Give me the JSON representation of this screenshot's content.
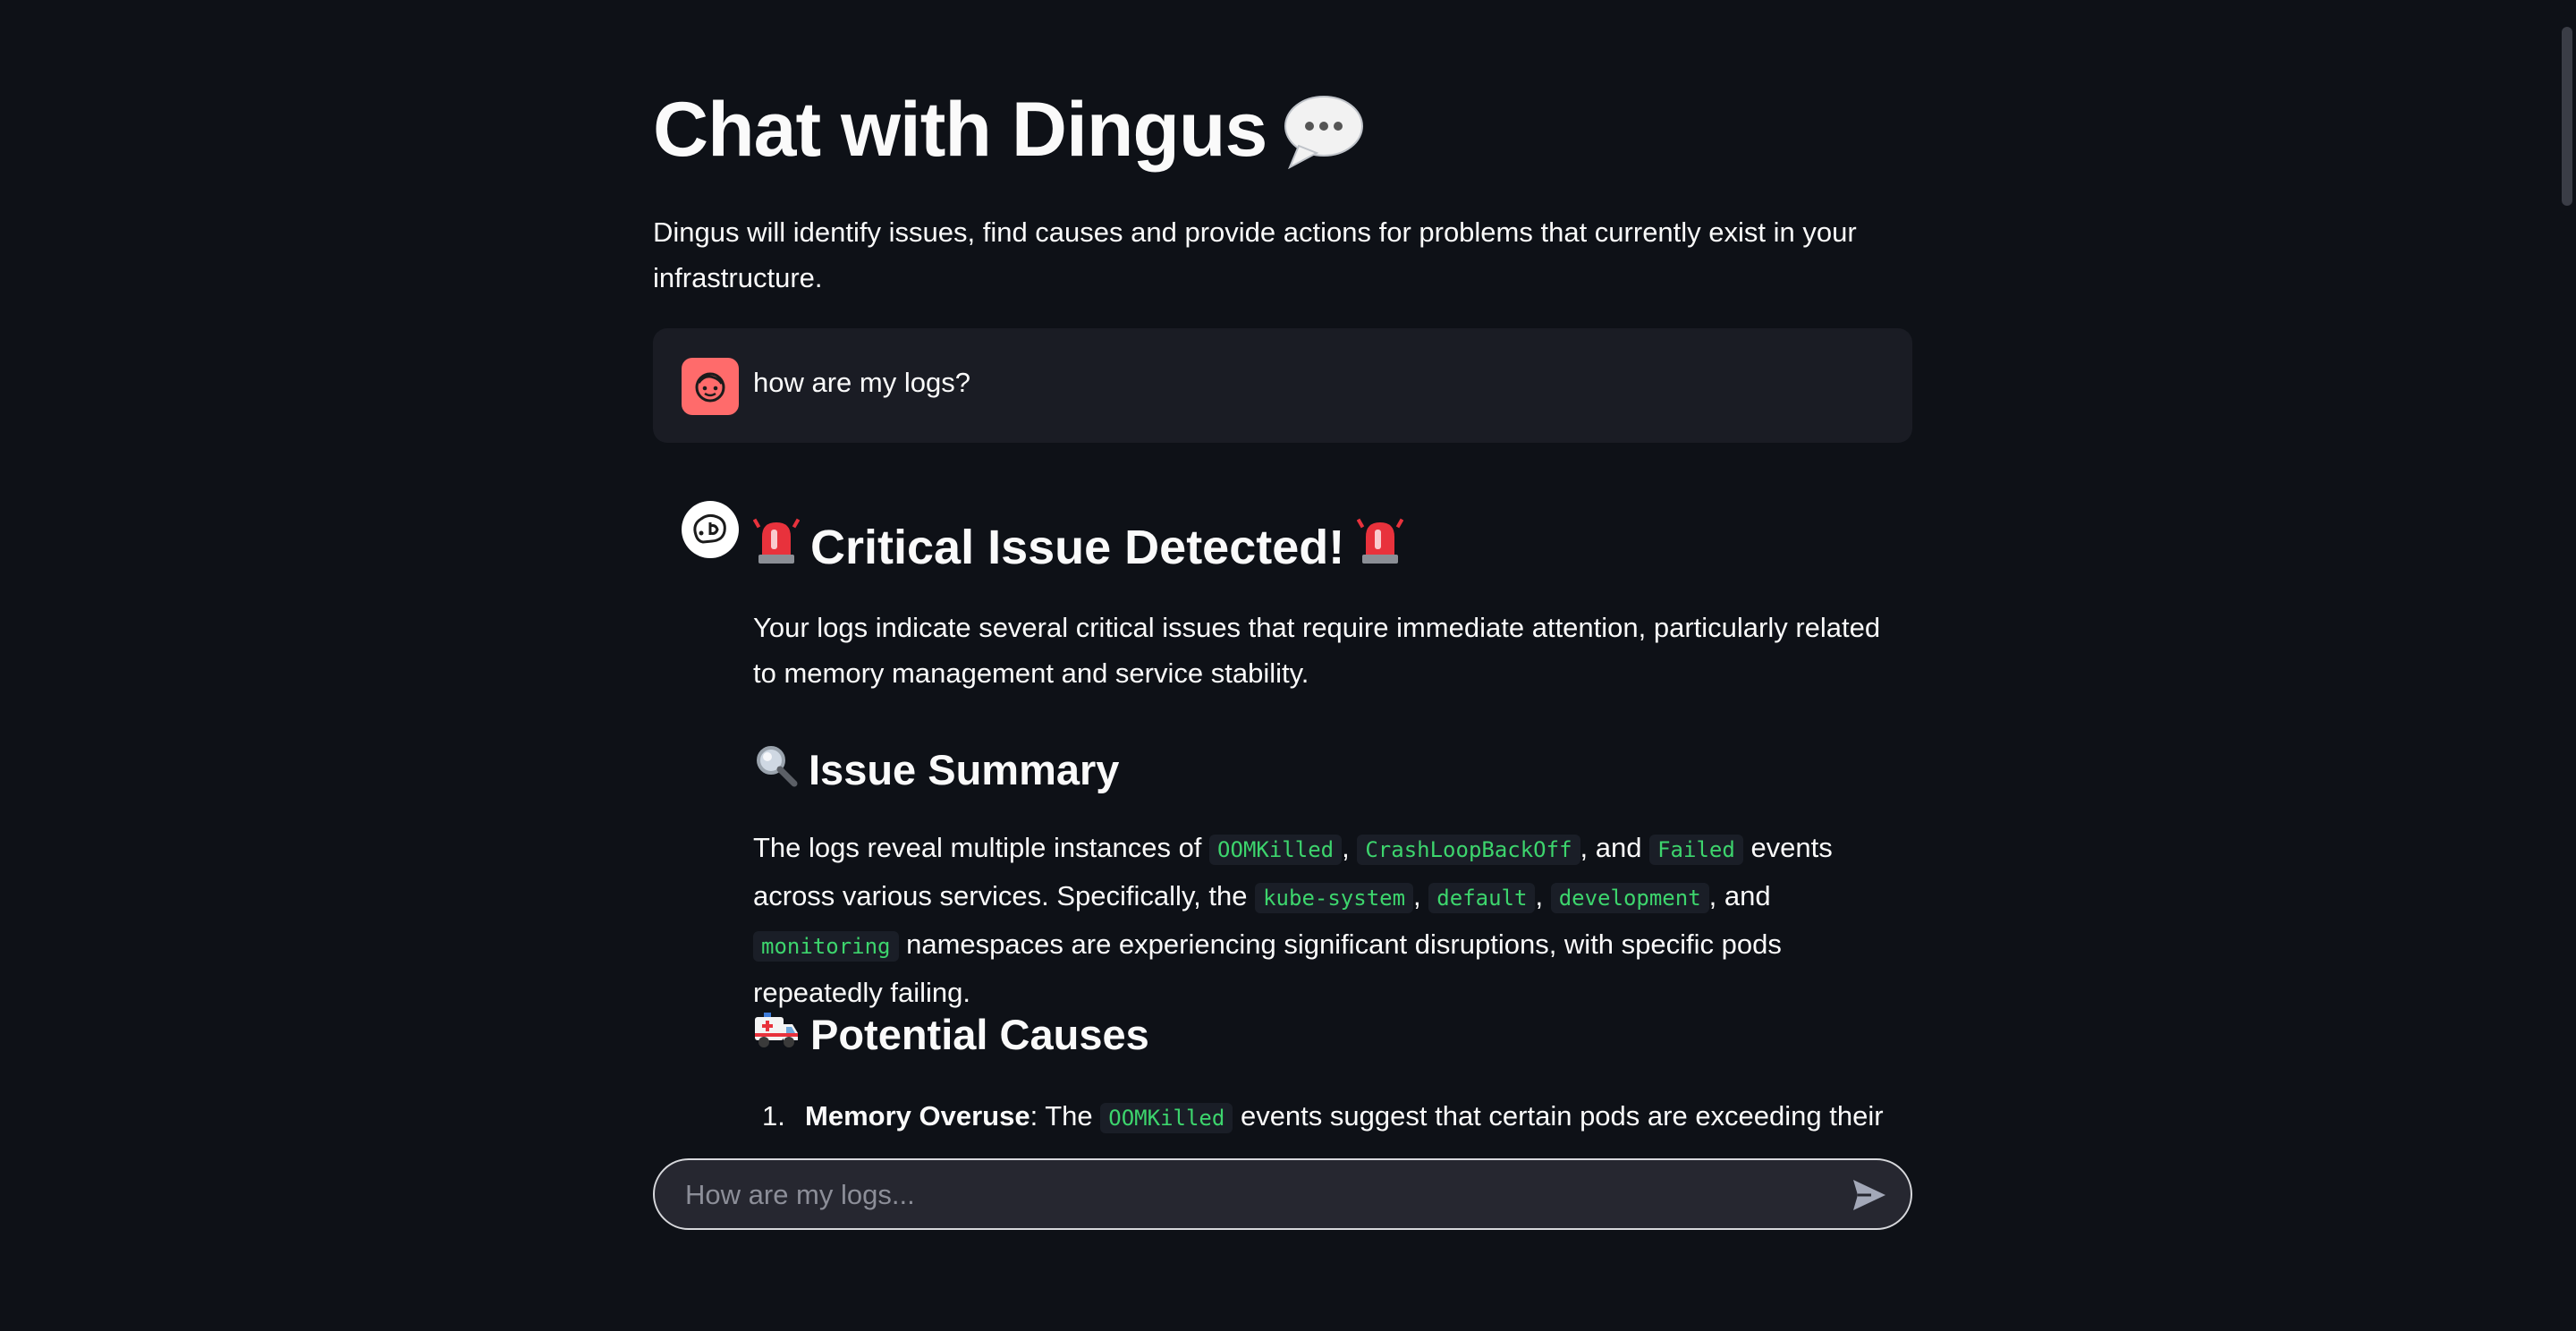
{
  "page": {
    "title": "Chat with Dingus",
    "title_icon": "speech-bubble-icon",
    "subtitle": "Dingus will identify issues, find causes and provide actions for problems that currently exist in your infrastructure."
  },
  "messages": {
    "user": {
      "avatar": "user-face-icon",
      "text": "how are my logs?"
    },
    "assistant": {
      "avatar": "bot-icon",
      "heading": "Critical Issue Detected!",
      "heading_icon": "police-light-icon",
      "intro": "Your logs indicate several critical issues that require immediate attention, particularly related to memory management and service stability.",
      "summary": {
        "heading": "Issue Summary",
        "icon": "magnifying-glass-icon",
        "t1": "The logs reveal multiple instances of",
        "c1": "OOMKilled",
        "t2": ",",
        "c2": "CrashLoopBackOff",
        "t3": ", and",
        "c3": "Failed",
        "t4": "events across various services. Specifically, the",
        "c4": "kube-system",
        "t5": ",",
        "c5": "default",
        "t6": ",",
        "c6": "development",
        "t7": ", and",
        "c7": "monitoring",
        "t8": "namespaces are experiencing significant disruptions, with specific pods repeatedly failing."
      },
      "causes": {
        "heading": "Potential Causes",
        "icon": "ambulance-icon",
        "items": [
          {
            "number": "1.",
            "title": "Memory Overuse",
            "t1": ": The",
            "code": "OOMKilled",
            "t2": "events suggest that certain pods are exceeding their"
          }
        ]
      }
    }
  },
  "chat_input": {
    "placeholder": "How are my logs..."
  },
  "colors": {
    "background": "#0e1117",
    "user_avatar": "#ff6b6b",
    "code_text": "#3dd56d",
    "user_bubble": "#1a1c24"
  }
}
